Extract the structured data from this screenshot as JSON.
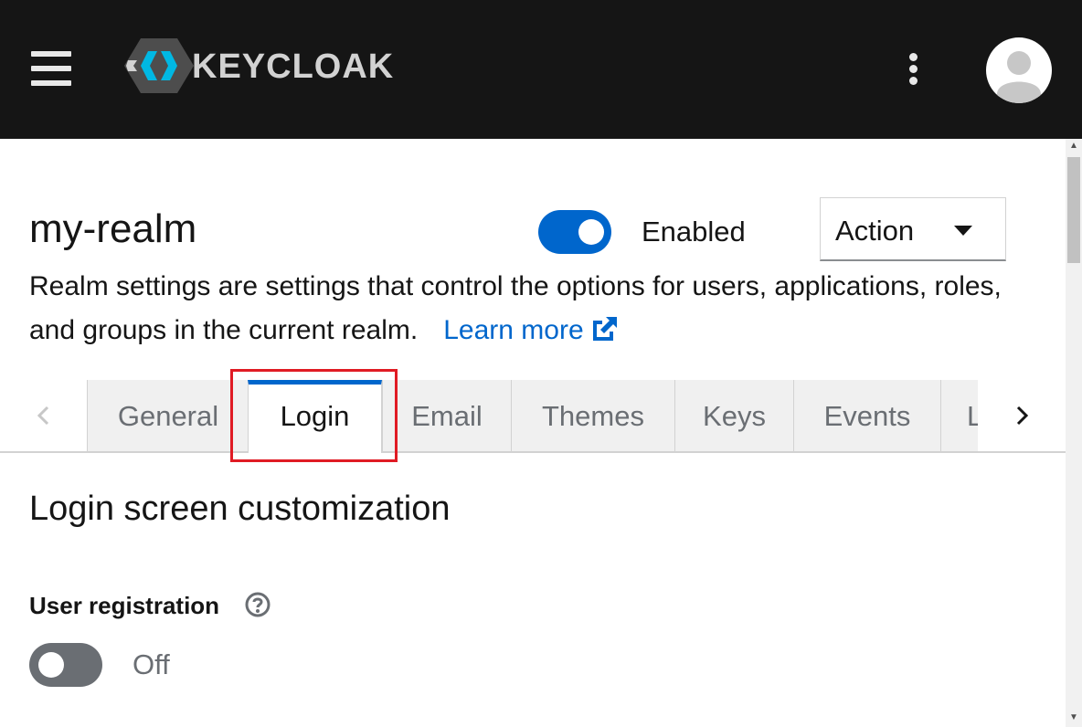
{
  "header": {
    "brand_text": "KEYCLOAK",
    "icons": [
      "hamburger-menu-icon",
      "keycloak-logo-icon",
      "kebab-menu-icon",
      "user-avatar-icon"
    ]
  },
  "realm": {
    "name": "my-realm",
    "enabled": true,
    "enabled_label": "Enabled",
    "action_label": "Action",
    "description": "Realm settings are settings that control the options for users, applications, roles, and groups in the current realm.",
    "learn_more": "Learn more"
  },
  "tabs": {
    "items": [
      {
        "label": "General"
      },
      {
        "label": "Login"
      },
      {
        "label": "Email"
      },
      {
        "label": "Themes"
      },
      {
        "label": "Keys"
      },
      {
        "label": "Events"
      },
      {
        "label": "L"
      }
    ],
    "active": "Login"
  },
  "login_section": {
    "title": "Login screen customization",
    "user_registration": {
      "label": "User registration",
      "value": false,
      "state_label": "Off"
    }
  },
  "colors": {
    "masthead_bg": "#151515",
    "accent": "#0066cc",
    "highlight": "#e01b24",
    "toggle_off": "#6a6e73"
  }
}
